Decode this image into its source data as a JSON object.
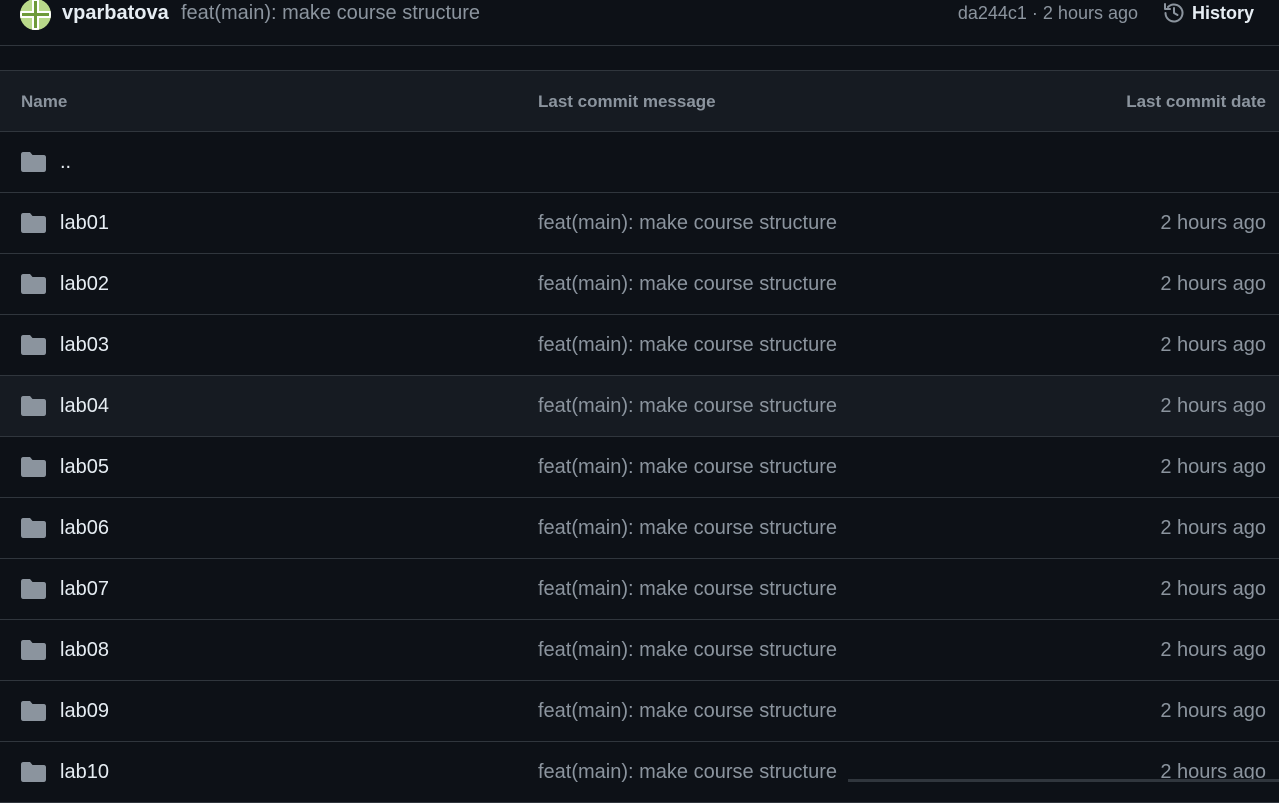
{
  "commit": {
    "author": "vparbatova",
    "message": "feat(main): make course structure",
    "meta": "da244c1 · 2 hours ago",
    "history_label": "History"
  },
  "table": {
    "headers": {
      "name": "Name",
      "message": "Last commit message",
      "date": "Last commit date"
    },
    "parent": "..",
    "rows": [
      {
        "name": "lab01",
        "message": "feat(main): make course structure",
        "date": "2 hours ago"
      },
      {
        "name": "lab02",
        "message": "feat(main): make course structure",
        "date": "2 hours ago"
      },
      {
        "name": "lab03",
        "message": "feat(main): make course structure",
        "date": "2 hours ago"
      },
      {
        "name": "lab04",
        "message": "feat(main): make course structure",
        "date": "2 hours ago"
      },
      {
        "name": "lab05",
        "message": "feat(main): make course structure",
        "date": "2 hours ago"
      },
      {
        "name": "lab06",
        "message": "feat(main): make course structure",
        "date": "2 hours ago"
      },
      {
        "name": "lab07",
        "message": "feat(main): make course structure",
        "date": "2 hours ago"
      },
      {
        "name": "lab08",
        "message": "feat(main): make course structure",
        "date": "2 hours ago"
      },
      {
        "name": "lab09",
        "message": "feat(main): make course structure",
        "date": "2 hours ago"
      },
      {
        "name": "lab10",
        "message": "feat(main): make course structure",
        "date": "2 hours ago"
      }
    ]
  },
  "colors": {
    "background": "#0d1117",
    "header_bg": "#161b22",
    "border": "#30363d",
    "text_primary": "#e6edf3",
    "text_muted": "#8b949e",
    "folder_icon": "#8b949e"
  },
  "icons": {
    "folder": "folder-icon",
    "history": "history-icon",
    "avatar": "avatar"
  }
}
